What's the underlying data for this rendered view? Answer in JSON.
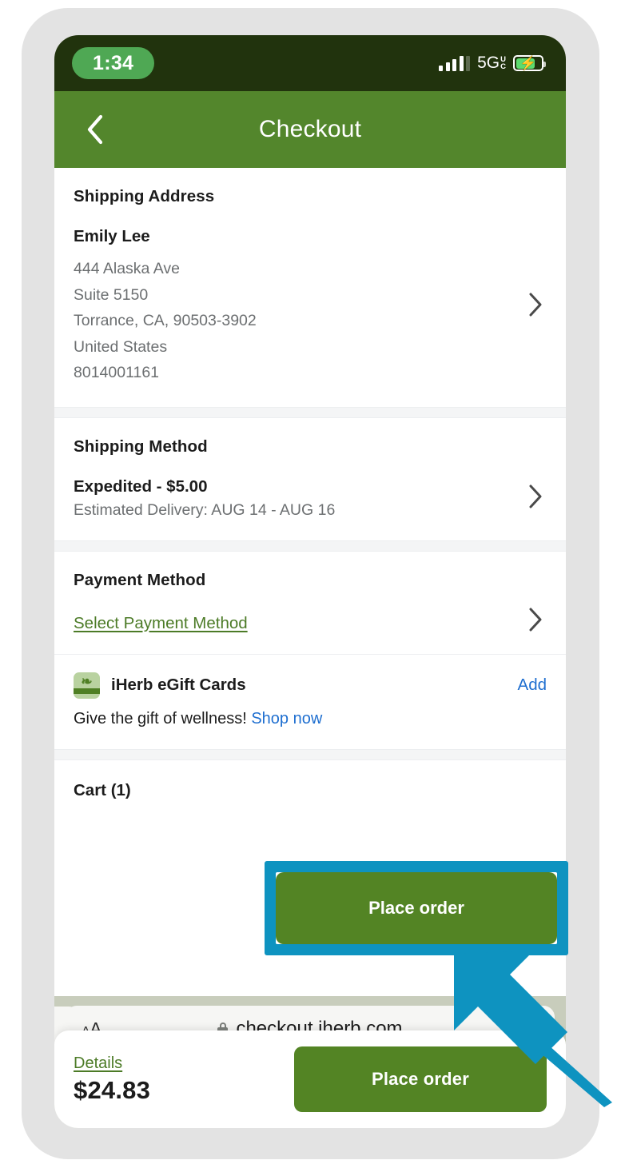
{
  "status_bar": {
    "time": "1:34",
    "network": "5G",
    "network_sub_top": "U",
    "network_sub_bottom": "C",
    "signal_bars": 4,
    "battery_charging": true,
    "pill_color": "#4fa854",
    "background_color": "#21330d"
  },
  "header": {
    "title": "Checkout",
    "back_icon": "chevron-left-icon",
    "background_color": "#53862c"
  },
  "shipping_address": {
    "heading": "Shipping Address",
    "name": "Emily Lee",
    "lines": [
      "444 Alaska Ave",
      "Suite 5150",
      "Torrance, CA, 90503-3902",
      "United States",
      "8014001161"
    ],
    "chevron_icon": "chevron-right-icon"
  },
  "shipping_method": {
    "heading": "Shipping Method",
    "option": "Expedited - $5.00",
    "estimate": "Estimated Delivery: AUG 14 - AUG 16",
    "chevron_icon": "chevron-right-icon"
  },
  "payment_method": {
    "heading": "Payment Method",
    "select_link": "Select Payment Method",
    "link_color": "#4c7b27",
    "chevron_icon": "chevron-right-icon"
  },
  "egift": {
    "icon": "gift-icon",
    "label": "iHerb eGift Cards",
    "add_label": "Add",
    "promo_text": "Give the gift of wellness!",
    "promo_link": "Shop now",
    "link_color": "#1f6fd0"
  },
  "cart": {
    "heading": "Cart (1)"
  },
  "action_bar": {
    "details_label": "Details",
    "total": "$24.83",
    "place_order_label": "Place order",
    "button_color": "#538424"
  },
  "browser": {
    "text_size_label_small": "A",
    "text_size_label_large": "A",
    "lock_icon": "lock-icon",
    "url": "checkout.iherb.com",
    "toolbar": [
      {
        "name": "back",
        "icon": "chevron-left-icon",
        "enabled": true
      },
      {
        "name": "forward",
        "icon": "chevron-right-icon",
        "enabled": false
      },
      {
        "name": "share",
        "icon": "share-icon",
        "enabled": true
      },
      {
        "name": "bookmarks",
        "icon": "book-icon",
        "enabled": true
      },
      {
        "name": "tabs",
        "icon": "tabs-icon",
        "enabled": true
      }
    ],
    "chrome_color": "#c8cdbc",
    "accent_color": "#2f7cf6"
  },
  "annotation": {
    "highlight_color": "#0e93c0",
    "target": "Place order",
    "arrow_icon": "arrow-up-left-icon"
  }
}
